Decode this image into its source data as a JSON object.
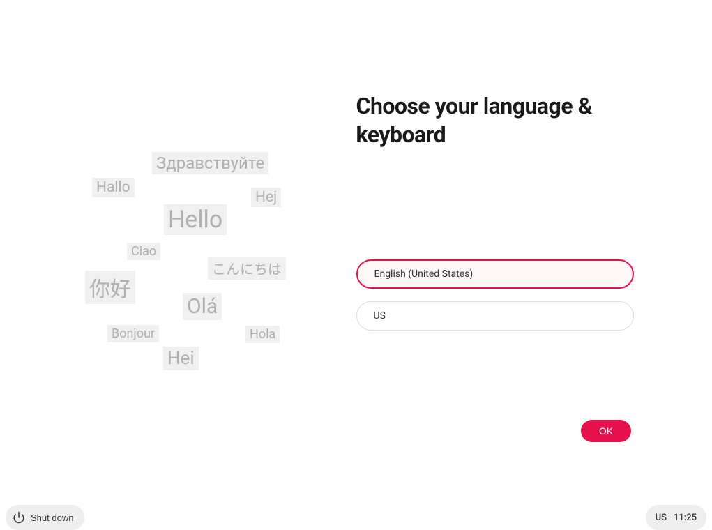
{
  "heading": "Choose your language & keyboard",
  "greetings": [
    "Здравствуйте",
    "Hallo",
    "Hej",
    "Hello",
    "Ciao",
    "こんにちは",
    "你好",
    "Olá",
    "Bonjour",
    "Hola",
    "Hei"
  ],
  "language_select": {
    "value": "English (United States)"
  },
  "keyboard_select": {
    "value": "US"
  },
  "ok_button": "OK",
  "shutdown_button": "Shut down",
  "status": {
    "keyboard_indicator": "US",
    "time": "11:25"
  },
  "colors": {
    "accent": "#e6104c",
    "greeting_text": "#b0b0b0",
    "greeting_bg": "#f0f0f0",
    "button_bg": "#eeeeee"
  }
}
